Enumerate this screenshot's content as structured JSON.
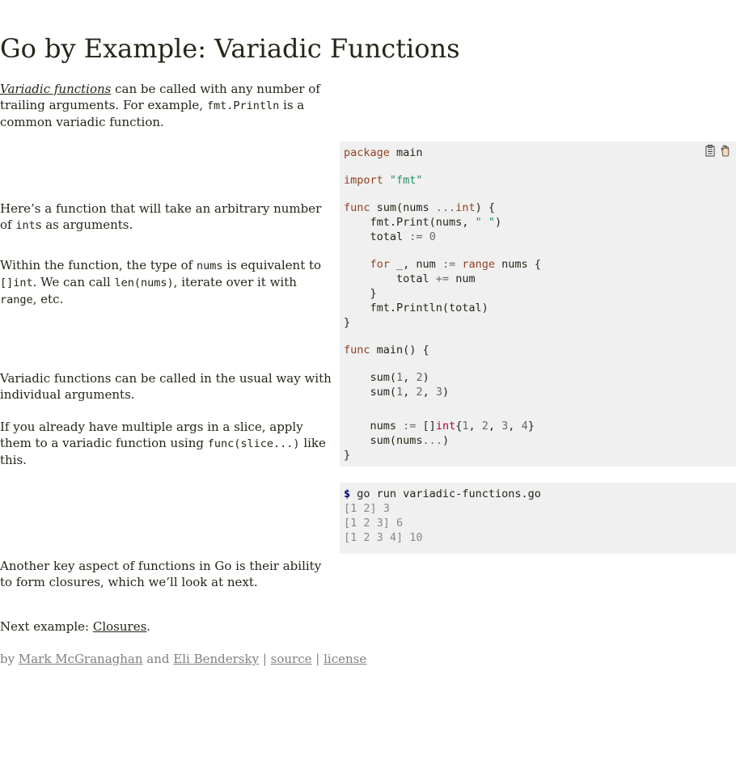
{
  "page": {
    "title": "Go by Example: Variadic Functions"
  },
  "intro": {
    "link": "Variadic functions",
    "text1": " can be called with any number of trailing arguments. For example, ",
    "code1": "fmt.Println",
    "text2": " is a common variadic function."
  },
  "doc2": {
    "text1": "Here’s a function that will take an arbitrary number of ",
    "code1": "int",
    "text2": "s as arguments."
  },
  "doc3": {
    "text1": "Within the function, the type of ",
    "code1": "nums",
    "text2": " is equivalent to ",
    "code2": "[]int",
    "text3": ". We can call ",
    "code3": "len(nums)",
    "text4": ", iterate over it with ",
    "code4": "range",
    "text5": ", etc."
  },
  "doc4": {
    "text": "Variadic functions can be called in the usual way with individual arguments."
  },
  "doc5": {
    "text1": "If you already have multiple args in a slice, apply them to a variadic function using ",
    "code1": "func(slice...)",
    "text2": " like this."
  },
  "doc6": {
    "text": "Another key aspect of functions in Go is their ability to form closures, which we’ll look at next."
  },
  "next": {
    "label": "Next example: ",
    "link": "Closures",
    "period": "."
  },
  "footer": {
    "by": "by ",
    "author1": "Mark McGranaghan",
    "and": " and ",
    "author2": "Eli Bendersky",
    "sep1": " | ",
    "source": "source",
    "sep2": " | ",
    "license": "license"
  },
  "code": {
    "package_kw": "package",
    "package_name": " main",
    "import_kw": "import",
    "import_path": "\"fmt\"",
    "func_kw": "func",
    "sum_sig1": " sum(nums ",
    "ellipsis": "...",
    "int_type": "int",
    "sum_sig2": ") {",
    "print_call1": "    fmt.Print(nums, ",
    "print_str": "\" \"",
    "print_call2": ")",
    "total_decl1": "    total ",
    "assign_op": ":=",
    "zero": "0",
    "for_kw": "    for",
    "for_mid1": " _, num ",
    "range_kw": "range",
    "for_mid2": " nums {",
    "total_add1": "        total ",
    "plus_eq": "+=",
    "total_add2": " num",
    "close_inner": "    }",
    "println_total": "    fmt.Println(total)",
    "close_func": "}",
    "main_kw": "func",
    "main_sig": " main() {",
    "sum12_a": "    sum(",
    "n1": "1",
    "comma": ", ",
    "n2": "2",
    "sum12_b": ")",
    "sum123_a": "    sum(",
    "n1b": "1",
    "comma_b": ", ",
    "n2b": "2",
    "comma_c": ", ",
    "n3b": "3",
    "sum123_b": ")",
    "nums_decl1": "    nums ",
    "assign_op2": ":=",
    "slice_open": " []",
    "int_type2": "int",
    "brace_open": "{",
    "s1": "1",
    "sc1": ", ",
    "s2": "2",
    "sc2": ", ",
    "s3": "3",
    "sc3": ", ",
    "s4": "4",
    "brace_close": "}",
    "sum_nums_a": "    sum(nums",
    "sum_nums_dots": "...",
    "sum_nums_b": ")",
    "close_main": "}"
  },
  "terminal": {
    "prompt": "$",
    "command": " go run variadic-functions.go",
    "out1": "[1 2] 3",
    "out2": "[1 2 3] 6",
    "out3": "[1 2 3 4] 10"
  },
  "icons": {
    "copy": "copy-icon",
    "run": "run-icon"
  }
}
